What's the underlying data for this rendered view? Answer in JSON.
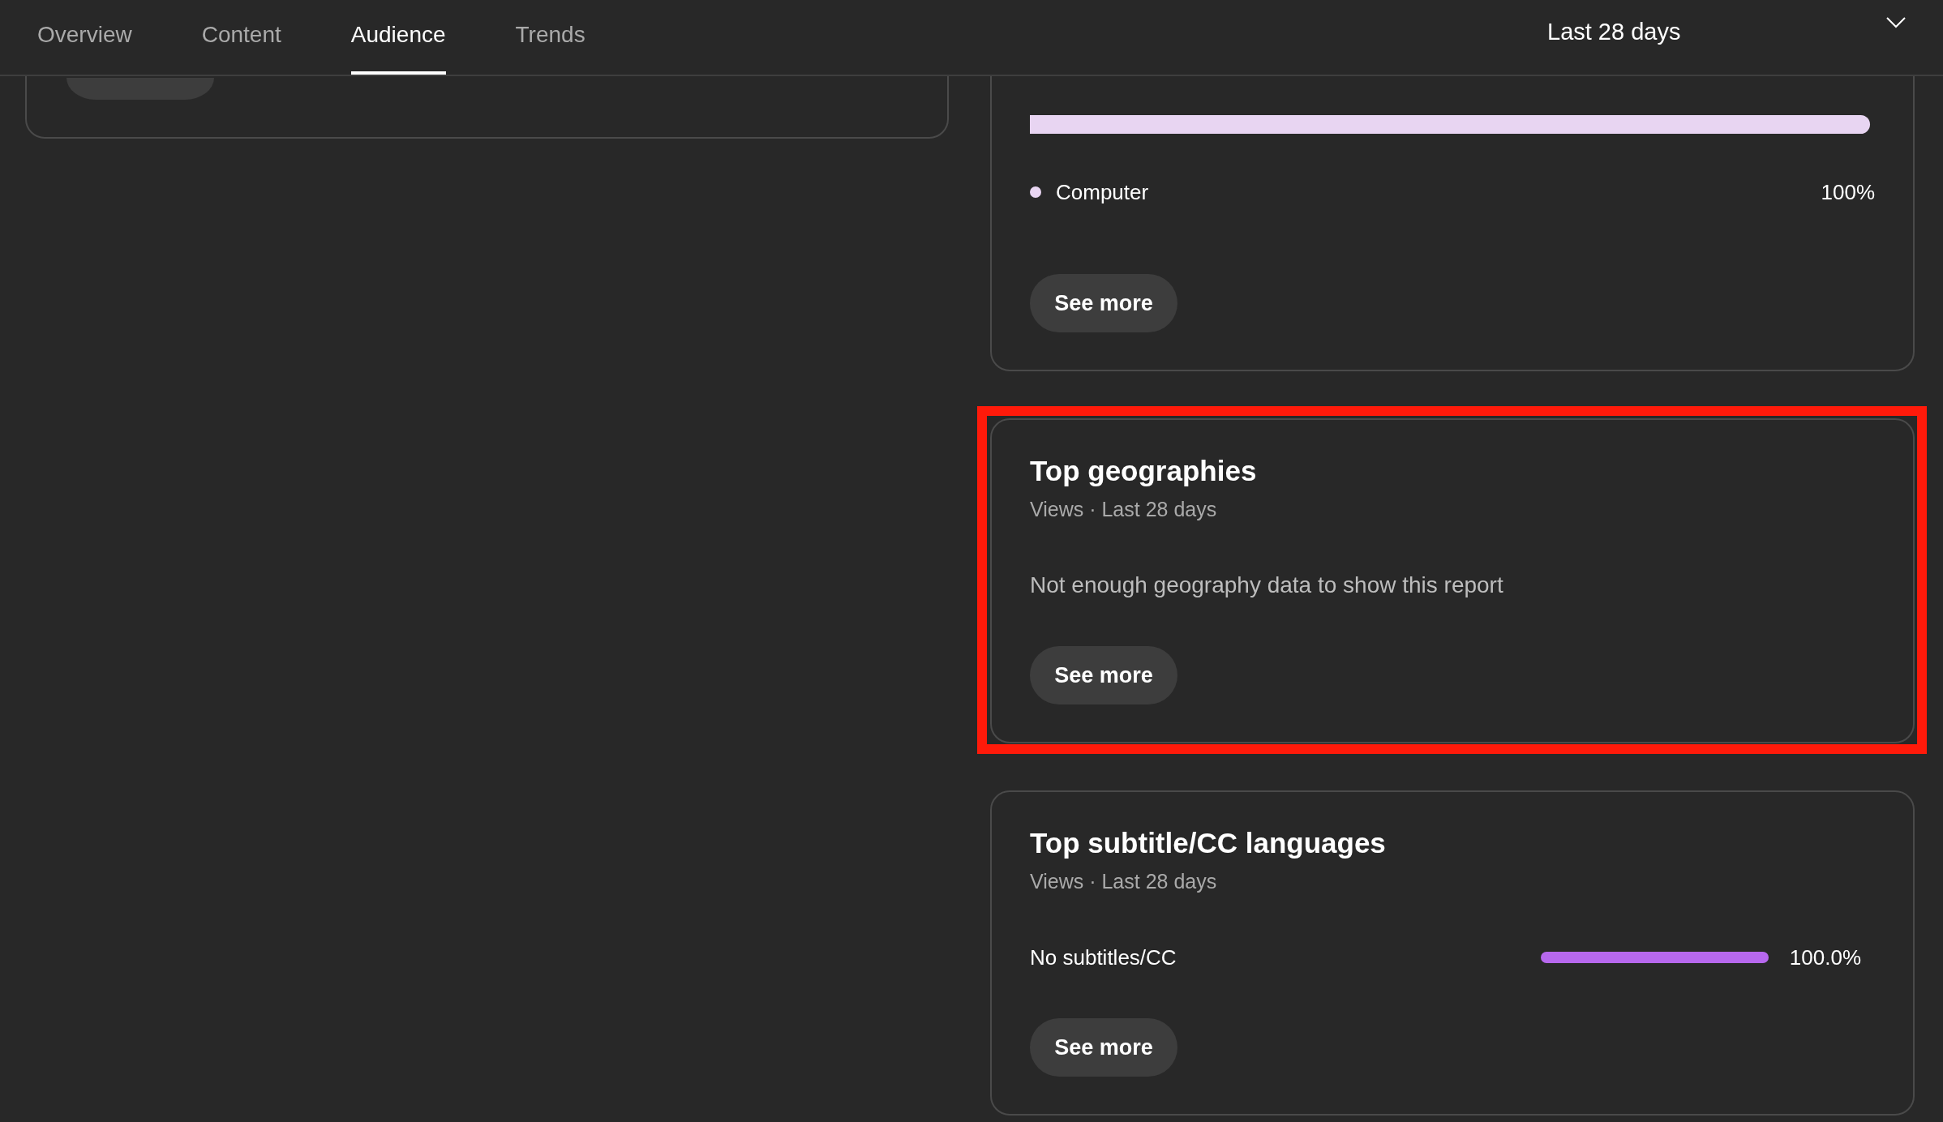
{
  "tabs": [
    {
      "label": "Overview",
      "selected": false
    },
    {
      "label": "Content",
      "selected": false
    },
    {
      "label": "Audience",
      "selected": true
    },
    {
      "label": "Trends",
      "selected": false
    }
  ],
  "date_range": {
    "label": "Last 28 days"
  },
  "cards": [
    {
      "kind": "device",
      "segments": [
        {
          "label": "Computer",
          "value": "100%",
          "level": 1,
          "color": "#e8d5f2"
        }
      ],
      "button": "See more",
      "highlighted": false
    },
    {
      "kind": "message",
      "title": "Top geographies",
      "subtitle": "Views · Last 28 days",
      "message": "Not enough geography data to show this report",
      "button": "See more",
      "highlighted": true
    },
    {
      "kind": "rows",
      "title": "Top subtitle/CC languages",
      "subtitle": "Views · Last 28 days",
      "rows": [
        {
          "label": "No subtitles/CC",
          "level": 1,
          "value": "100.0%"
        }
      ],
      "button": "See more",
      "highlighted": false
    }
  ]
}
